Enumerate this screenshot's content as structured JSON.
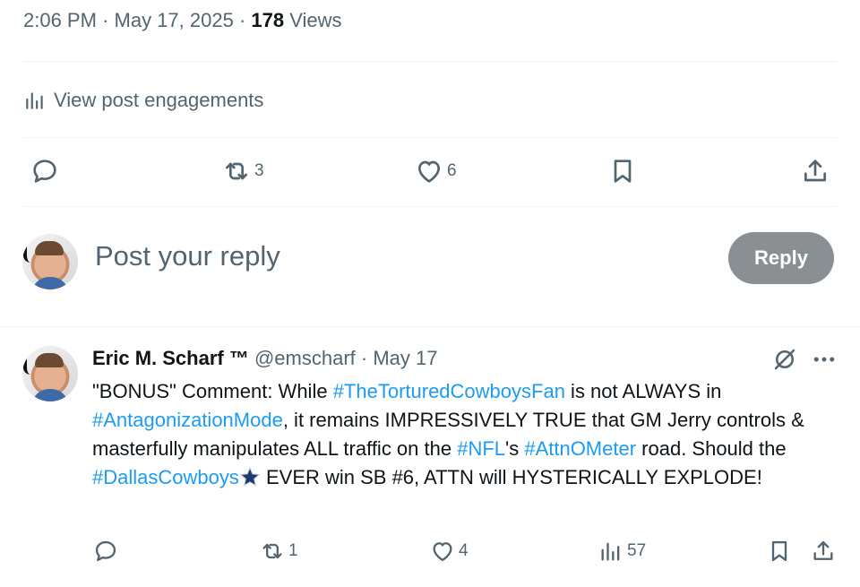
{
  "post_meta": {
    "time": "2:06 PM",
    "sep1": "·",
    "date": "May 17, 2025",
    "sep2": "·",
    "views_count": "178",
    "views_label": "Views"
  },
  "engagements": {
    "label": "View post engagements",
    "icon": "analytics-icon"
  },
  "actions": {
    "reply": {
      "icon": "reply-icon"
    },
    "repost": {
      "icon": "repost-icon",
      "count": "3"
    },
    "like": {
      "icon": "heart-icon",
      "count": "6"
    },
    "bookmark": {
      "icon": "bookmark-icon"
    },
    "share": {
      "icon": "share-icon"
    }
  },
  "compose": {
    "placeholder": "Post your reply",
    "button": "Reply"
  },
  "reply_tweet": {
    "name": "Eric M. Scharf ™",
    "handle": "@emscharf",
    "sep": "·",
    "date": "May 17",
    "body": {
      "t1": "\"BONUS\" Comment: While ",
      "h1": "#TheTorturedCowboysFan",
      "t2": " is not ALWAYS in ",
      "h2": "#AntagonizationMode",
      "t3": ", it remains IMPRESSIVELY TRUE that GM Jerry controls & masterfully manipulates ALL traffic on the ",
      "h3": "#NFL",
      "t4": "'s ",
      "h4": "#AttnOMeter",
      "t5": " road. Should the ",
      "h5": "#DallasCowboys",
      "t6": " EVER win SB #6, ATTN will HYSTERICALLY EXPLODE!"
    },
    "actions": {
      "reply": {
        "icon": "reply-icon"
      },
      "repost": {
        "icon": "repost-icon",
        "count": "1"
      },
      "like": {
        "icon": "heart-icon",
        "count": "4"
      },
      "views": {
        "icon": "analytics-icon",
        "count": "57"
      },
      "bookmark": {
        "icon": "bookmark-icon"
      },
      "share": {
        "icon": "share-icon"
      }
    },
    "header_icons": [
      "grok-icon",
      "more-icon"
    ]
  },
  "colors": {
    "text": "#0f1419",
    "muted": "#536471",
    "link": "#1d9bf0",
    "divider": "#eff3f4",
    "reply_button": "#8a8f93",
    "star": "#1f3a6e"
  }
}
